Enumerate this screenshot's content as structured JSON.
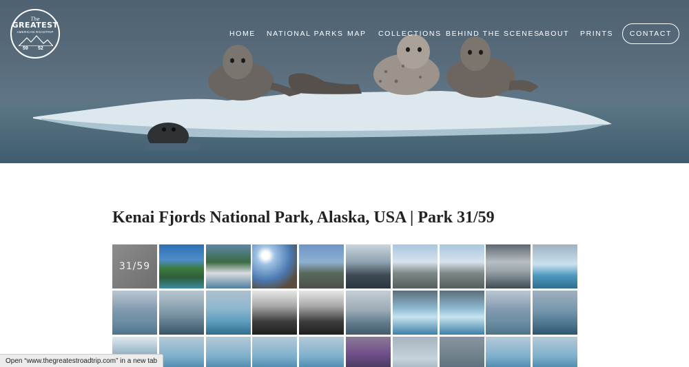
{
  "logo": {
    "line_the": "The",
    "line_main": "GREATEST",
    "line_sub": "AMERICAN ROADTRIP",
    "num_left": "59",
    "num_right": "52"
  },
  "nav": {
    "items": [
      "HOME",
      "NATIONAL PARKS",
      "MAP",
      "COLLECTIONS",
      "BEHIND THE SCENES",
      "ABOUT",
      "PRINTS"
    ],
    "contact": "CONTACT"
  },
  "page": {
    "title": "Kenai Fjords National Park, Alaska, USA | Park 31/59"
  },
  "gallery": {
    "first_label": "31/59",
    "thumbs": [
      "label",
      "green-coast",
      "marina",
      "sunny-peak",
      "rocky-mountain",
      "rocky-cliff",
      "tent-beach",
      "tent-beach",
      "kayak-bay",
      "kayak-iceberg",
      "kayak-green",
      "kayaker-orange",
      "glacier-blue",
      "glacier-bw",
      "glacier-bw",
      "glacier-fog",
      "ice-field",
      "ice-field",
      "kayak-green",
      "kayak-red",
      "ice-wall",
      "ice-blue",
      "ice-blue",
      "ice-blue",
      "ice-blue",
      "bag-purple",
      "ice-grey",
      "grey-sky",
      "ice-blue",
      "ice-blue"
    ]
  },
  "status": {
    "text": "Open “www.thegreatestroadtrip.com” in a new tab"
  }
}
